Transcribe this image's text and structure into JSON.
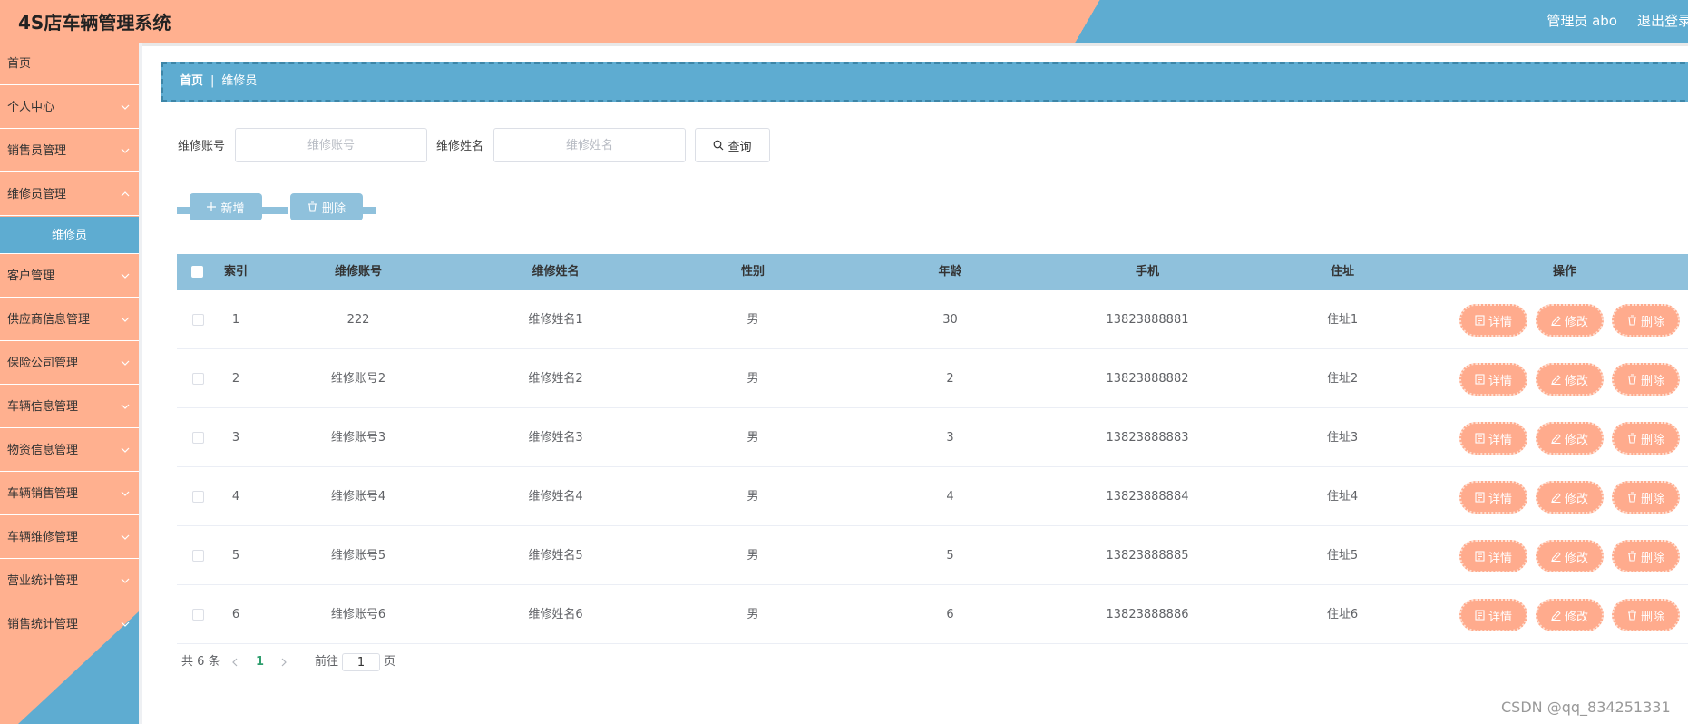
{
  "header": {
    "title": "4S店车辆管理系统",
    "admin": "管理员 abo",
    "logout": "退出登录"
  },
  "sidebar": {
    "items": [
      {
        "label": "首页",
        "expandable": false
      },
      {
        "label": "个人中心",
        "expandable": true
      },
      {
        "label": "销售员管理",
        "expandable": true
      },
      {
        "label": "维修员管理",
        "expandable": true,
        "expanded": true
      },
      {
        "label": "维修员",
        "active": true
      },
      {
        "label": "客户管理",
        "expandable": true
      },
      {
        "label": "供应商信息管理",
        "expandable": true
      },
      {
        "label": "保险公司管理",
        "expandable": true
      },
      {
        "label": "车辆信息管理",
        "expandable": true
      },
      {
        "label": "物资信息管理",
        "expandable": true
      },
      {
        "label": "车辆销售管理",
        "expandable": true
      },
      {
        "label": "车辆维修管理",
        "expandable": true
      },
      {
        "label": "营业统计管理",
        "expandable": true
      },
      {
        "label": "销售统计管理",
        "expandable": true
      }
    ]
  },
  "breadcrumb": {
    "home": "首页",
    "separator": "|",
    "current": "维修员"
  },
  "search": {
    "account_label": "维修账号",
    "account_placeholder": "维修账号",
    "name_label": "维修姓名",
    "name_placeholder": "维修姓名",
    "search_button": "查询"
  },
  "actions": {
    "add": "新增",
    "delete": "删除"
  },
  "table": {
    "headers": [
      "索引",
      "维修账号",
      "维修姓名",
      "性别",
      "年龄",
      "手机",
      "住址",
      "操作"
    ],
    "rows": [
      {
        "index": "1",
        "account": "222",
        "name": "维修姓名1",
        "gender": "男",
        "age": "30",
        "phone": "13823888881",
        "address": "住址1"
      },
      {
        "index": "2",
        "account": "维修账号2",
        "name": "维修姓名2",
        "gender": "男",
        "age": "2",
        "phone": "13823888882",
        "address": "住址2"
      },
      {
        "index": "3",
        "account": "维修账号3",
        "name": "维修姓名3",
        "gender": "男",
        "age": "3",
        "phone": "13823888883",
        "address": "住址3"
      },
      {
        "index": "4",
        "account": "维修账号4",
        "name": "维修姓名4",
        "gender": "男",
        "age": "4",
        "phone": "13823888884",
        "address": "住址4"
      },
      {
        "index": "5",
        "account": "维修账号5",
        "name": "维修姓名5",
        "gender": "男",
        "age": "5",
        "phone": "13823888885",
        "address": "住址5"
      },
      {
        "index": "6",
        "account": "维修账号6",
        "name": "维修姓名6",
        "gender": "男",
        "age": "6",
        "phone": "13823888886",
        "address": "住址6"
      }
    ],
    "row_actions": {
      "detail": "详情",
      "edit": "修改",
      "delete": "删除"
    }
  },
  "pagination": {
    "total": "共 6 条",
    "current_page": "1",
    "goto_label": "前往",
    "goto_value": "1",
    "page_suffix": "页"
  },
  "watermark": "CSDN @qq_834251331",
  "colors": {
    "salmon": "#ffb08f",
    "blue": "#5eacd1",
    "light_blue": "#8fc1dc",
    "button_salmon": "#ffab8d",
    "active_page": "#2f9e6e"
  },
  "icons": {
    "search": "search-icon",
    "add": "plus-icon",
    "delete": "trash-icon",
    "detail": "document-icon",
    "edit": "pencil-icon",
    "expand": "chevron-down-icon"
  }
}
